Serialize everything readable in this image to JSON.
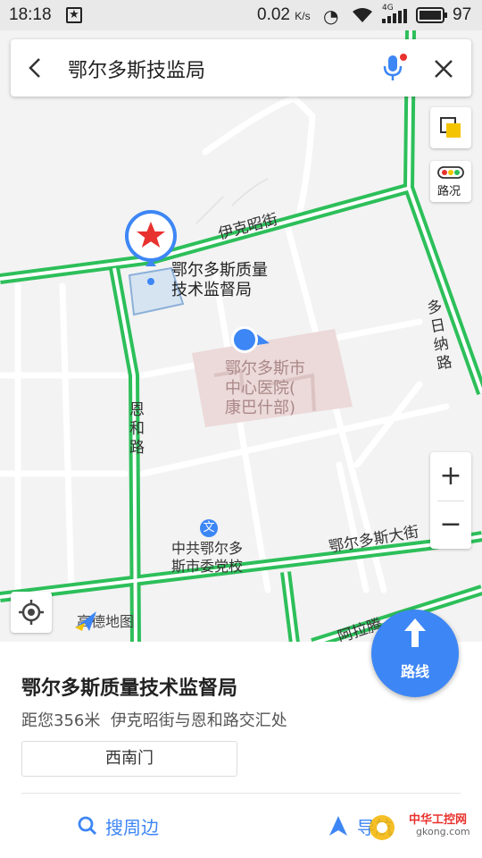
{
  "status_bar": {
    "time": "18:18",
    "speed": "0.02",
    "speed_unit": "K/s",
    "network": "4G",
    "battery": "97"
  },
  "search": {
    "query": "鄂尔多斯技监局"
  },
  "map": {
    "traffic_label": "路况",
    "poi_label": "鄂尔多斯质量\n技术监督局",
    "hospital_label": "鄂尔多斯市\n中心医院(\n康巴什部)",
    "school_label": "中共鄂尔多\n斯市委党校",
    "school_icon": "文",
    "streets": {
      "yikezhao": "伊克昭街",
      "enhe": "恩\n和\n路",
      "duori": "多\n日\n纳\n路",
      "ordos_da": "鄂尔多斯大街",
      "alatan": "阿拉腾"
    },
    "logo_text": "高德地图",
    "zoom_in": "+",
    "zoom_out": "−"
  },
  "route_button": {
    "label": "路线"
  },
  "detail": {
    "title": "鄂尔多斯质量技术监督局",
    "distance_text": "距您356米",
    "address": "伊克昭街与恩和路交汇处",
    "gate": "西南门",
    "search_nearby": "搜周边",
    "navigate": "导航"
  },
  "watermark": {
    "text1": "中华工控网",
    "text2": "gkong.com"
  },
  "colors": {
    "road_green": "#2dbf5a",
    "accent_blue": "#3d86f5",
    "pin_red": "#e8322e",
    "hospital": "#ecd9d9"
  }
}
